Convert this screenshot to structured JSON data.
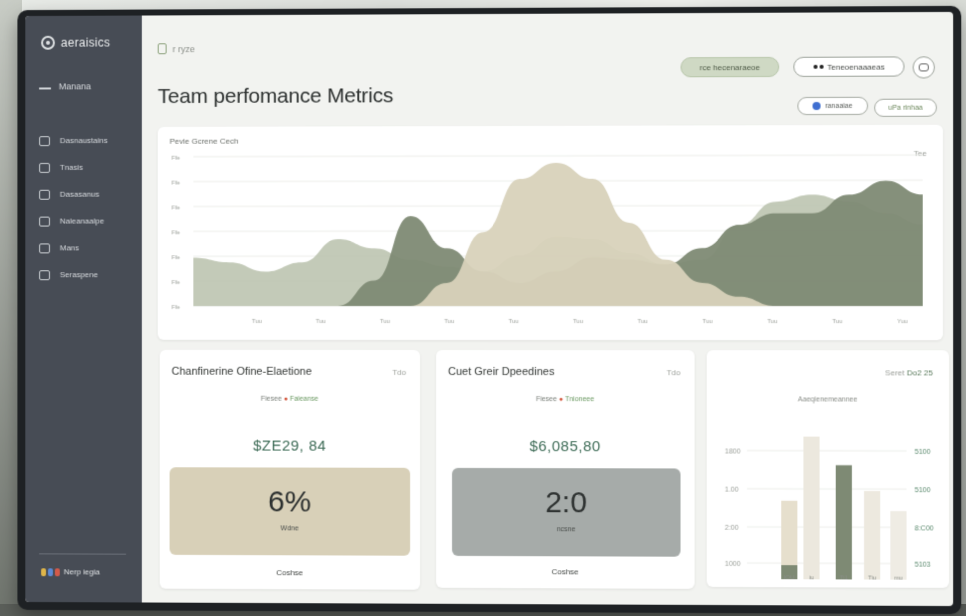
{
  "app": {
    "brand": "aeraisics"
  },
  "sidebar": {
    "home_label": "Manana",
    "items": [
      {
        "label": "Dasnaustains",
        "icon": "dashboard-icon"
      },
      {
        "label": "Tnasis",
        "icon": "tasks-icon"
      },
      {
        "label": "Dasasanus",
        "icon": "reports-icon"
      },
      {
        "label": "Naleanaalpe",
        "icon": "analytics-icon"
      },
      {
        "label": "Mans",
        "icon": "calendar-icon"
      },
      {
        "label": "Seraspene",
        "icon": "settings-icon"
      }
    ],
    "footer_label": "Nerp iegia"
  },
  "header": {
    "breadcrumb": "r  ryze",
    "title": "Team perfomance Metrics",
    "status_pill": "rce hecenaraeoe",
    "user_pill": "Teneoenaaaeas",
    "filter1": "ranaaiae",
    "filter2": "uPa rinhaa"
  },
  "main_chart": {
    "title": "Pevie Gcrene Cech",
    "corner": "Tee"
  },
  "chart_data": {
    "type": "area",
    "title": "Pevie Gcrene Cech",
    "x_ticks": [
      "Tuu",
      "Tuu",
      "Tuu",
      "Tuu",
      "Tuu",
      "Tuu",
      "Tuu",
      "Tuu",
      "Tuu",
      "Tuu",
      "Yuu"
    ],
    "y_ticks": [
      "Ffe",
      "Ffe",
      "Ffe",
      "Ffe",
      "Ffe",
      "Ffe",
      "Ffe"
    ],
    "series": [
      {
        "color": "#b9c1ac",
        "values": [
          42,
          38,
          30,
          38,
          58,
          50,
          40,
          34,
          30,
          44,
          60,
          58,
          46,
          36,
          40,
          70,
          90,
          96,
          90,
          80,
          70
        ]
      },
      {
        "color": "#7e8a74",
        "values": [
          0,
          0,
          0,
          0,
          0,
          22,
          78,
          50,
          30,
          20,
          30,
          42,
          40,
          36,
          50,
          70,
          80,
          80,
          96,
          108,
          96
        ]
      },
      {
        "color": "#d8d2ba",
        "values": [
          0,
          0,
          0,
          0,
          0,
          0,
          0,
          20,
          64,
          110,
          124,
          110,
          72,
          40,
          20,
          8,
          0,
          0,
          0,
          0,
          0
        ]
      }
    ]
  },
  "kpi_cards": [
    {
      "title": "Chanfinerine Ofine-Elaetione",
      "corner": "Tdo",
      "sub_a": "Fiesee",
      "sub_b": "Faieanse",
      "value": "$ZE29, 84",
      "big": "6%",
      "small": "Wdne",
      "foot": "Coshse"
    },
    {
      "title": "Cuet Greir Dpeedines",
      "corner": "Tdo",
      "sub_a": "Fiesee",
      "sub_b": "Tnioneee",
      "value": "$6,085,80",
      "big": "2:0",
      "small": "ncsne",
      "foot": "Coshse"
    }
  ],
  "bar_card": {
    "head_a": "Seret",
    "head_b": "Do2 25",
    "sub": "Aaeqienemeannee",
    "left_ticks": [
      "1800",
      "1.00",
      "2:00",
      "1000"
    ],
    "right_ticks": [
      "5100",
      "5100",
      "8:C00",
      "5103"
    ],
    "x_labels": [
      "IOU",
      "iu",
      "Ti1",
      "Tiu",
      "mu"
    ],
    "bars": [
      {
        "h": 0.55,
        "color": "#e6dfcd"
      },
      {
        "h": 1.0,
        "color": "#ece8de"
      },
      {
        "h": 0.8,
        "color": "#7e8a74"
      },
      {
        "h": 0.62,
        "color": "#ede9df"
      },
      {
        "h": 0.48,
        "color": "#efece4"
      }
    ]
  }
}
